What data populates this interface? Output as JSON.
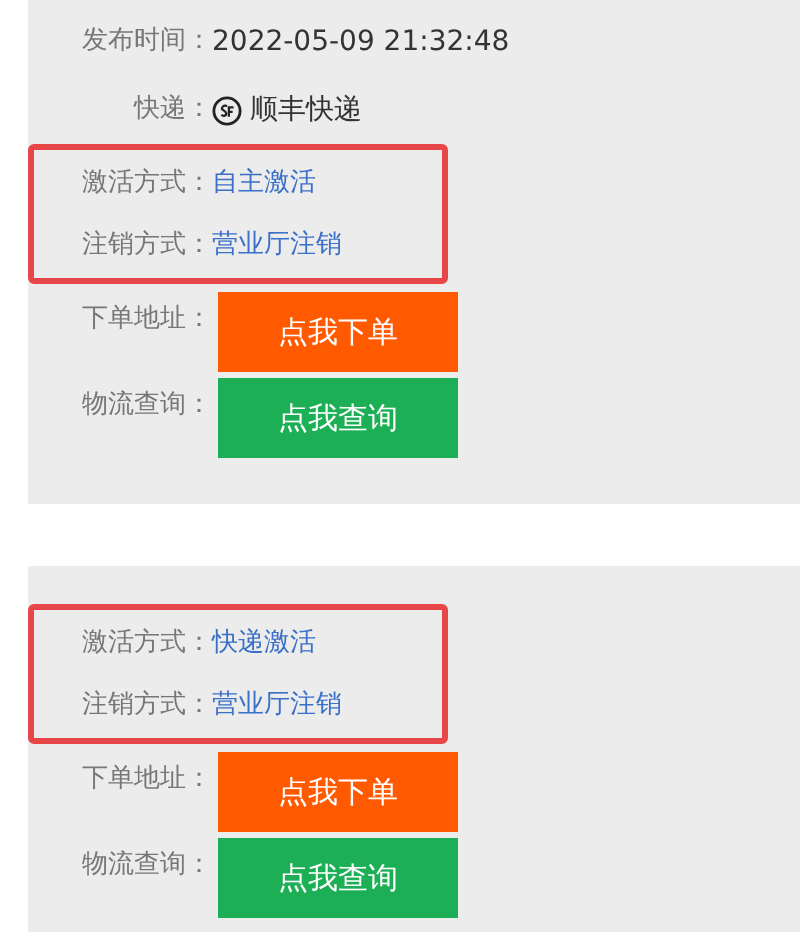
{
  "panels": [
    {
      "info": [
        {
          "kind": "text",
          "label": "发布时间：",
          "value": "2022-05-09 21:32:48"
        },
        {
          "kind": "express",
          "label": "快递：",
          "value": "顺丰快递"
        }
      ],
      "highlighted": [
        {
          "label": "激活方式：",
          "value": "自主激活"
        },
        {
          "label": "注销方式：",
          "value": "营业厅注销"
        }
      ],
      "actions": [
        {
          "label": "下单地址：",
          "button": "点我下单",
          "color": "#ff5a00"
        },
        {
          "label": "物流查询：",
          "button": "点我查询",
          "color": "#1daf55"
        }
      ]
    },
    {
      "highlighted": [
        {
          "label": "激活方式：",
          "value": "快递激活"
        },
        {
          "label": "注销方式：",
          "value": "营业厅注销"
        }
      ],
      "actions": [
        {
          "label": "下单地址：",
          "button": "点我下单",
          "color": "#ff5a00"
        },
        {
          "label": "物流查询：",
          "button": "点我查询",
          "color": "#1daf55"
        }
      ]
    }
  ]
}
